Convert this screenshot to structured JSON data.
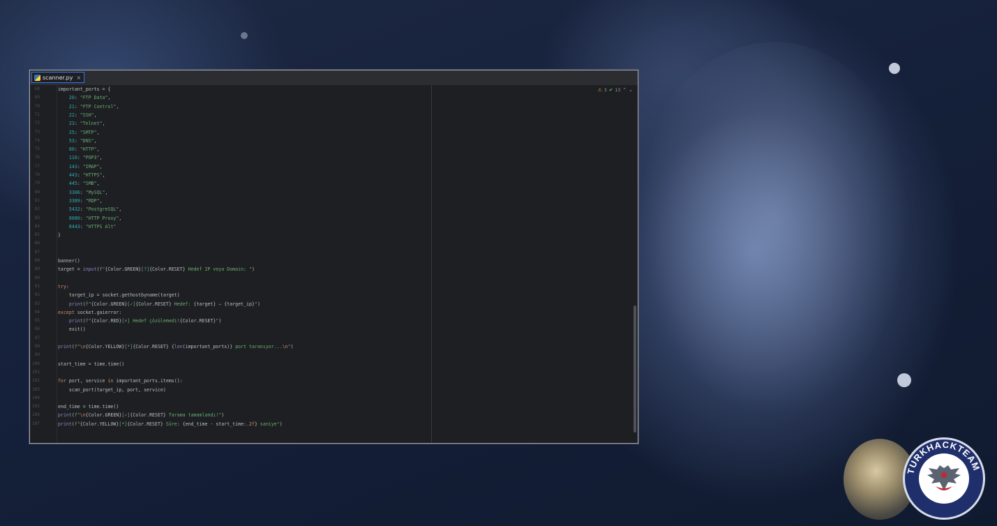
{
  "tab": {
    "filename": "scanner.py",
    "close": "×"
  },
  "inspections": {
    "warnings": "3",
    "weak_warnings": "13",
    "warn_symbol": "⚠",
    "ok_symbol": "✔",
    "up": "⌃",
    "down": "⌄"
  },
  "logo": {
    "text": "TURKHACKTEAM"
  },
  "lines": [
    {
      "n": "68",
      "html": "important_ports = {"
    },
    {
      "n": "69",
      "html": "    <span class=\"num\">20</span>: <span class=\"str\">\"FTP Data\"</span>,"
    },
    {
      "n": "70",
      "html": "    <span class=\"num\">21</span>: <span class=\"str\">\"FTP Control\"</span>,"
    },
    {
      "n": "71",
      "html": "    <span class=\"num\">22</span>: <span class=\"str\">\"SSH\"</span>,"
    },
    {
      "n": "72",
      "html": "    <span class=\"num\">23</span>: <span class=\"str\">\"Telnet\"</span>,"
    },
    {
      "n": "73",
      "html": "    <span class=\"num\">25</span>: <span class=\"str\">\"SMTP\"</span>,"
    },
    {
      "n": "74",
      "html": "    <span class=\"num\">53</span>: <span class=\"str\">\"DNS\"</span>,"
    },
    {
      "n": "75",
      "html": "    <span class=\"num\">80</span>: <span class=\"str\">\"HTTP\"</span>,"
    },
    {
      "n": "76",
      "html": "    <span class=\"num\">110</span>: <span class=\"str\">\"POP3\"</span>,"
    },
    {
      "n": "77",
      "html": "    <span class=\"num\">143</span>: <span class=\"str\">\"IMAP\"</span>,"
    },
    {
      "n": "78",
      "html": "    <span class=\"num\">443</span>: <span class=\"str\">\"HTTPS\"</span>,"
    },
    {
      "n": "79",
      "html": "    <span class=\"num\">445</span>: <span class=\"str\">\"SMB\"</span>,"
    },
    {
      "n": "80",
      "html": "    <span class=\"num\">3306</span>: <span class=\"str\">\"MySQL\"</span>,"
    },
    {
      "n": "81",
      "html": "    <span class=\"num\">3389</span>: <span class=\"str\">\"RDP\"</span>,"
    },
    {
      "n": "82",
      "html": "    <span class=\"num\">5432</span>: <span class=\"str\">\"PostgreSQL\"</span>,"
    },
    {
      "n": "83",
      "html": "    <span class=\"num\">8080</span>: <span class=\"str\">\"HTTP Proxy\"</span>,"
    },
    {
      "n": "84",
      "html": "    <span class=\"num\">8443</span>: <span class=\"str\">\"HTTPS Alt\"</span>"
    },
    {
      "n": "85",
      "html": "}"
    },
    {
      "n": "86",
      "html": ""
    },
    {
      "n": "87",
      "html": ""
    },
    {
      "n": "88",
      "html": "banner()"
    },
    {
      "n": "89",
      "html": "target = <span class=\"bi\">input</span>(<span class=\"str\">f\"</span>{Color.GREEN}<span class=\"str\">[?]</span>{Color.RESET}<span class=\"str\"> Hedef IP veya Domain: \"</span>)"
    },
    {
      "n": "90",
      "html": ""
    },
    {
      "n": "91",
      "html": "<span class=\"kw\">try</span>:"
    },
    {
      "n": "92",
      "html": "    target_ip = socket.gethostbyname(target)"
    },
    {
      "n": "93",
      "html": "    <span class=\"bi\">print</span>(<span class=\"str\">f\"</span>{Color.GREEN}<span class=\"str\">[✓]</span>{Color.RESET}<span class=\"str\"> Hedef: </span>{target}<span class=\"str\"> → </span>{target_ip}<span class=\"str\">\"</span>)"
    },
    {
      "n": "94",
      "html": "<span class=\"kw\">except</span> socket.gaierror:"
    },
    {
      "n": "95",
      "html": "    <span class=\"bi\">print</span>(<span class=\"str\">f\"</span>{Color.RED}<span class=\"str\">[×] Hedef çözülemedi!</span>{Color.RESET}<span class=\"str\">\"</span>)"
    },
    {
      "n": "96",
      "html": "    exit()"
    },
    {
      "n": "97",
      "html": ""
    },
    {
      "n": "98",
      "html": "<span class=\"bi\">print</span>(<span class=\"str\">f\"</span><span class=\"esc\">\\n</span>{Color.YELLOW}<span class=\"str\">[*]</span>{Color.RESET}<span class=\"str\"> </span>{<span class=\"bi\">len</span>(important_ports)}<span class=\"str\"> port taranıyor...</span><span class=\"esc\">\\n</span><span class=\"str\">\"</span>)"
    },
    {
      "n": "99",
      "html": ""
    },
    {
      "n": "100",
      "html": "start_time = time.time()"
    },
    {
      "n": "101",
      "html": ""
    },
    {
      "n": "102",
      "html": "<span class=\"kw\">for</span> port, service <span class=\"kw\">in</span> important_ports.items():"
    },
    {
      "n": "103",
      "html": "    scan_port(target_ip, port, service)"
    },
    {
      "n": "104",
      "html": ""
    },
    {
      "n": "105",
      "html": "end_time = time.time()"
    },
    {
      "n": "106",
      "html": "<span class=\"bi\">print</span>(<span class=\"str\">f\"</span><span class=\"esc\">\\n</span>{Color.GREEN}<span class=\"str\">[✓]</span>{Color.RESET}<span class=\"str\"> Tarama tamamlandı!\"</span>)"
    },
    {
      "n": "107",
      "html": "<span class=\"bi\">print</span>(<span class=\"str\">f\"</span>{Color.YELLOW}<span class=\"str\">[*]</span>{Color.RESET}<span class=\"str\"> Süre: </span>{end_time - start_time<span class=\"kw\">:.2f</span>}<span class=\"str\"> saniye\"</span>)"
    }
  ]
}
